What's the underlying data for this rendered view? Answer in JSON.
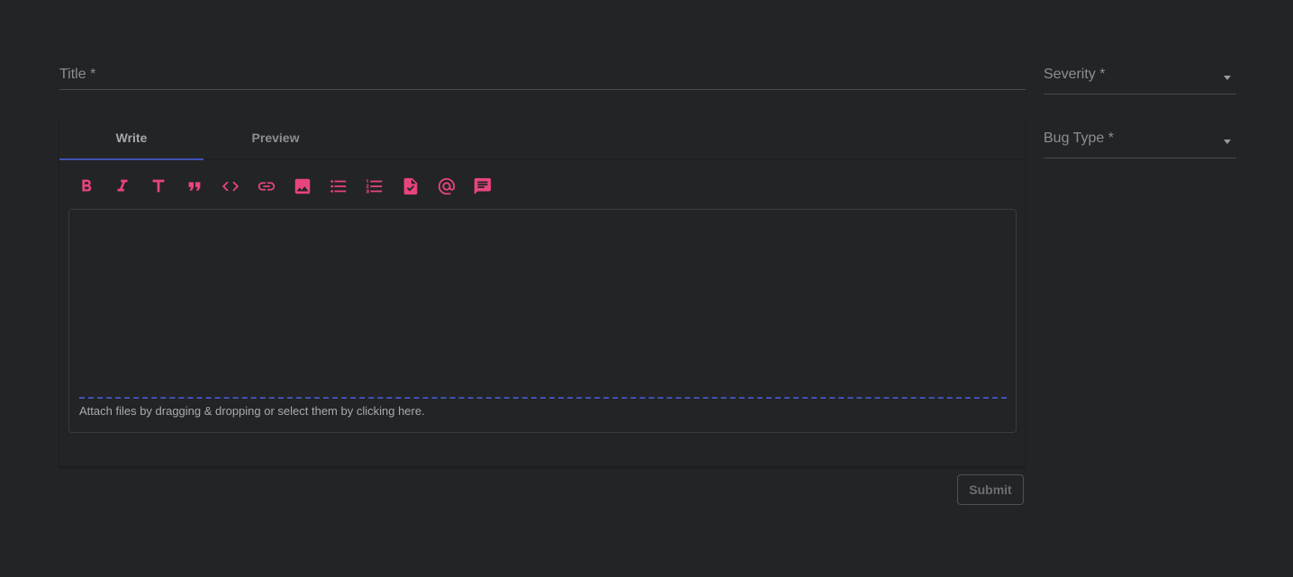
{
  "form": {
    "title_label": "Title *",
    "severity_label": "Severity *",
    "bug_type_label": "Bug Type *",
    "submit_label": "Submit"
  },
  "editor": {
    "tabs": [
      {
        "label": "Write",
        "active": true
      },
      {
        "label": "Preview",
        "active": false
      }
    ],
    "toolbar": [
      "bold-icon",
      "italic-icon",
      "heading-icon",
      "quote-icon",
      "code-icon",
      "link-icon",
      "image-icon",
      "bulleted-list-icon",
      "numbered-list-icon",
      "task-list-icon",
      "mention-icon",
      "saved-reply-icon"
    ],
    "dropzone_text": "Attach files by dragging & dropping or select them by clicking here."
  },
  "colors": {
    "background": "#232426",
    "accent_pink": "#e8447e",
    "accent_indigo": "#3f51b5"
  }
}
